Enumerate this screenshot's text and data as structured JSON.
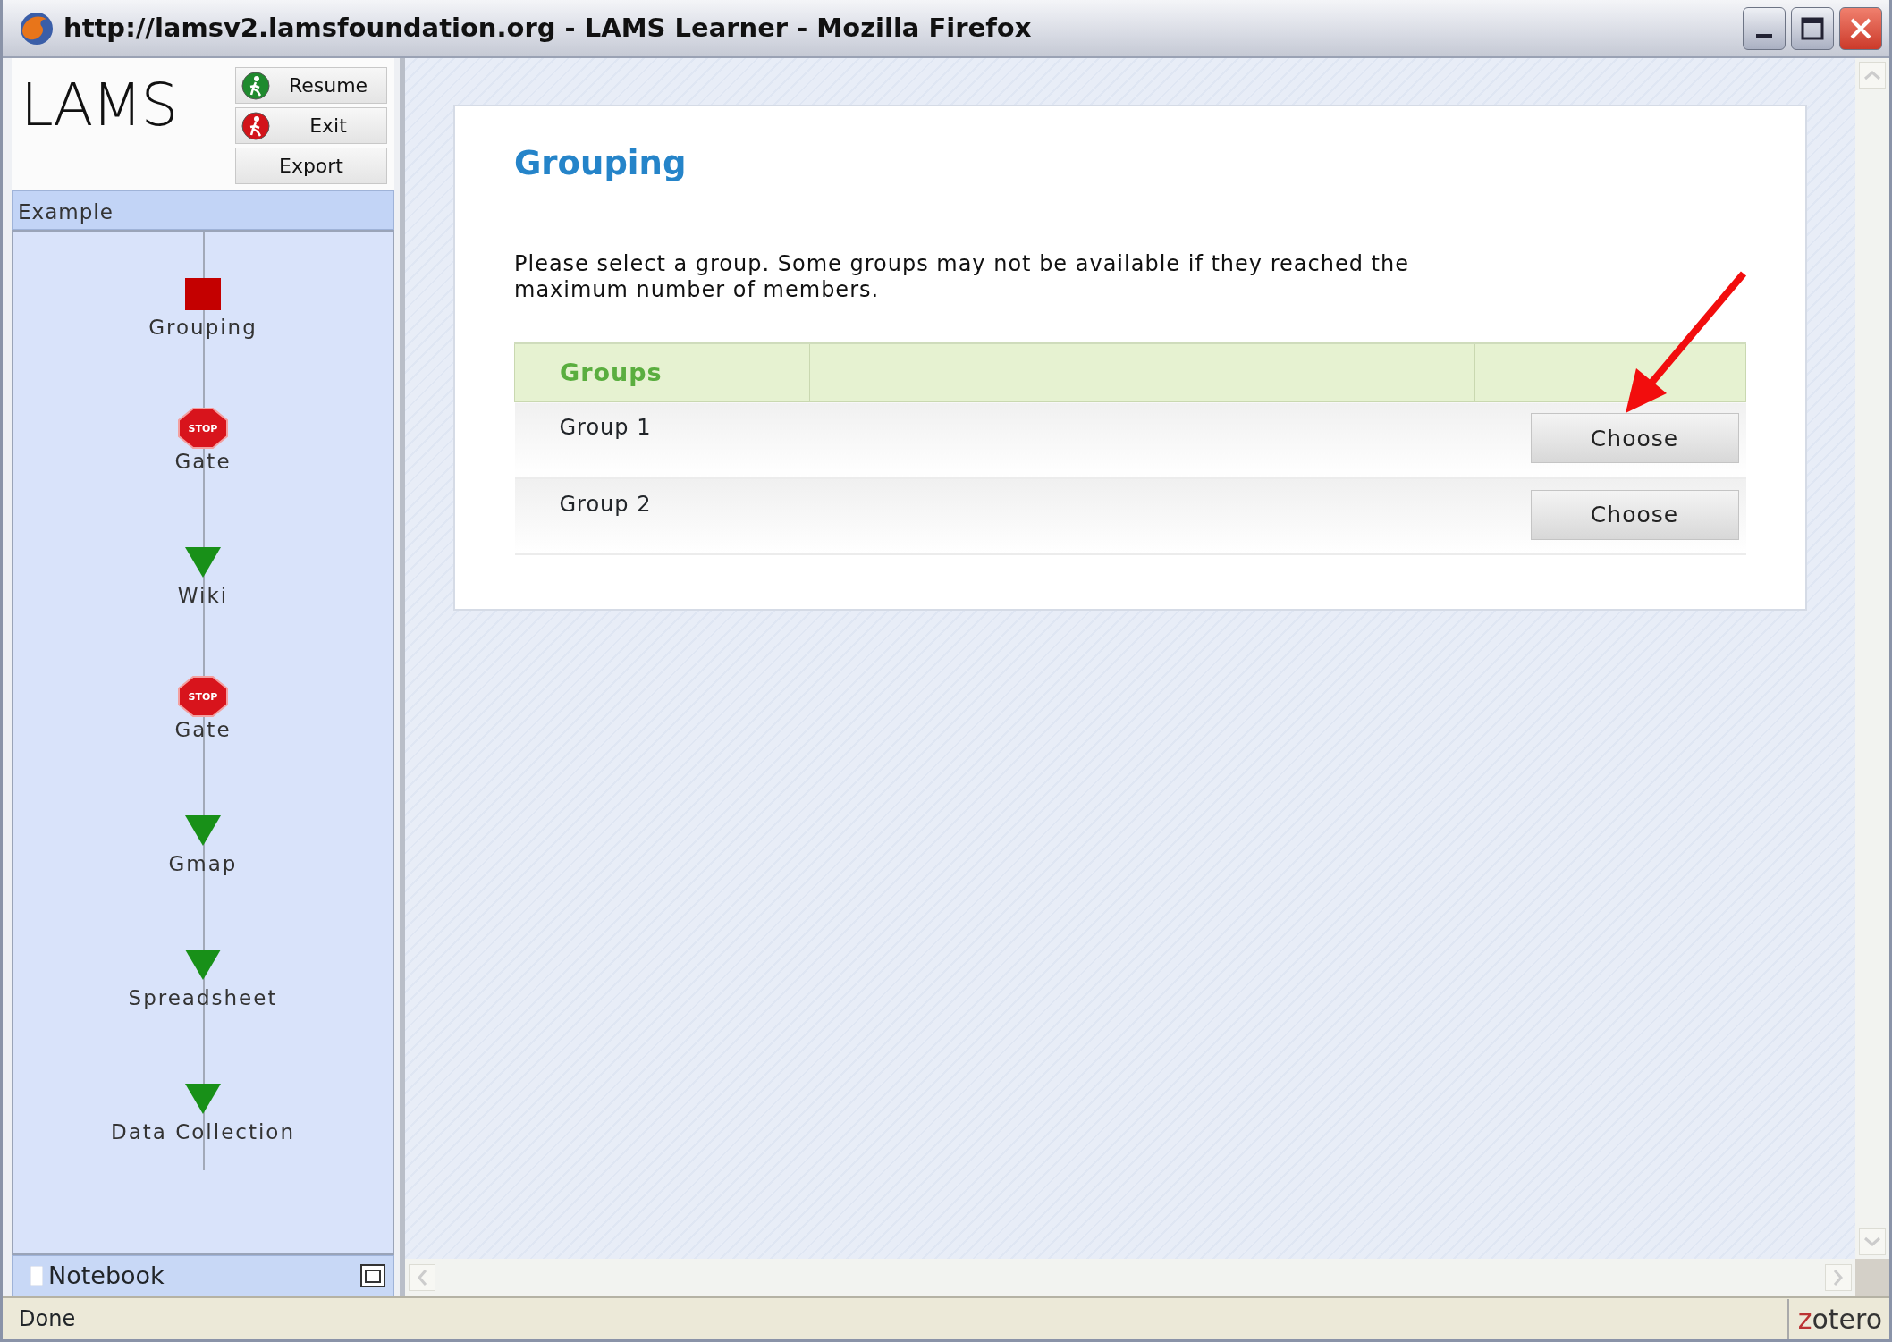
{
  "window": {
    "title": "http://lamsv2.lamsfoundation.org - LAMS Learner - Mozilla Firefox"
  },
  "sidebar": {
    "logo": "LAMS",
    "buttons": [
      {
        "label": "Resume",
        "kind": "resume"
      },
      {
        "label": "Exit",
        "kind": "exit"
      },
      {
        "label": "Export",
        "kind": "plain"
      }
    ],
    "sequence_title": "Example",
    "activities": [
      {
        "label": "Grouping",
        "kind": "current"
      },
      {
        "label": "Gate",
        "kind": "gate",
        "sign": "STOP"
      },
      {
        "label": "Wiki",
        "kind": "todo"
      },
      {
        "label": "Gate",
        "kind": "gate",
        "sign": "STOP"
      },
      {
        "label": "Gmap",
        "kind": "todo"
      },
      {
        "label": "Spreadsheet",
        "kind": "todo"
      },
      {
        "label": "Data Collection",
        "kind": "todo"
      }
    ],
    "notebook": "Notebook"
  },
  "main": {
    "title": "Grouping",
    "instructions": "Please select a group. Some groups may not be available if they reached the maximum number of members.",
    "table": {
      "columns": [
        "Groups"
      ],
      "rows": [
        {
          "name": "Group 1",
          "action": "Choose"
        },
        {
          "name": "Group 2",
          "action": "Choose"
        }
      ]
    }
  },
  "status_bar": {
    "text": "Done",
    "badge": "zotero"
  }
}
